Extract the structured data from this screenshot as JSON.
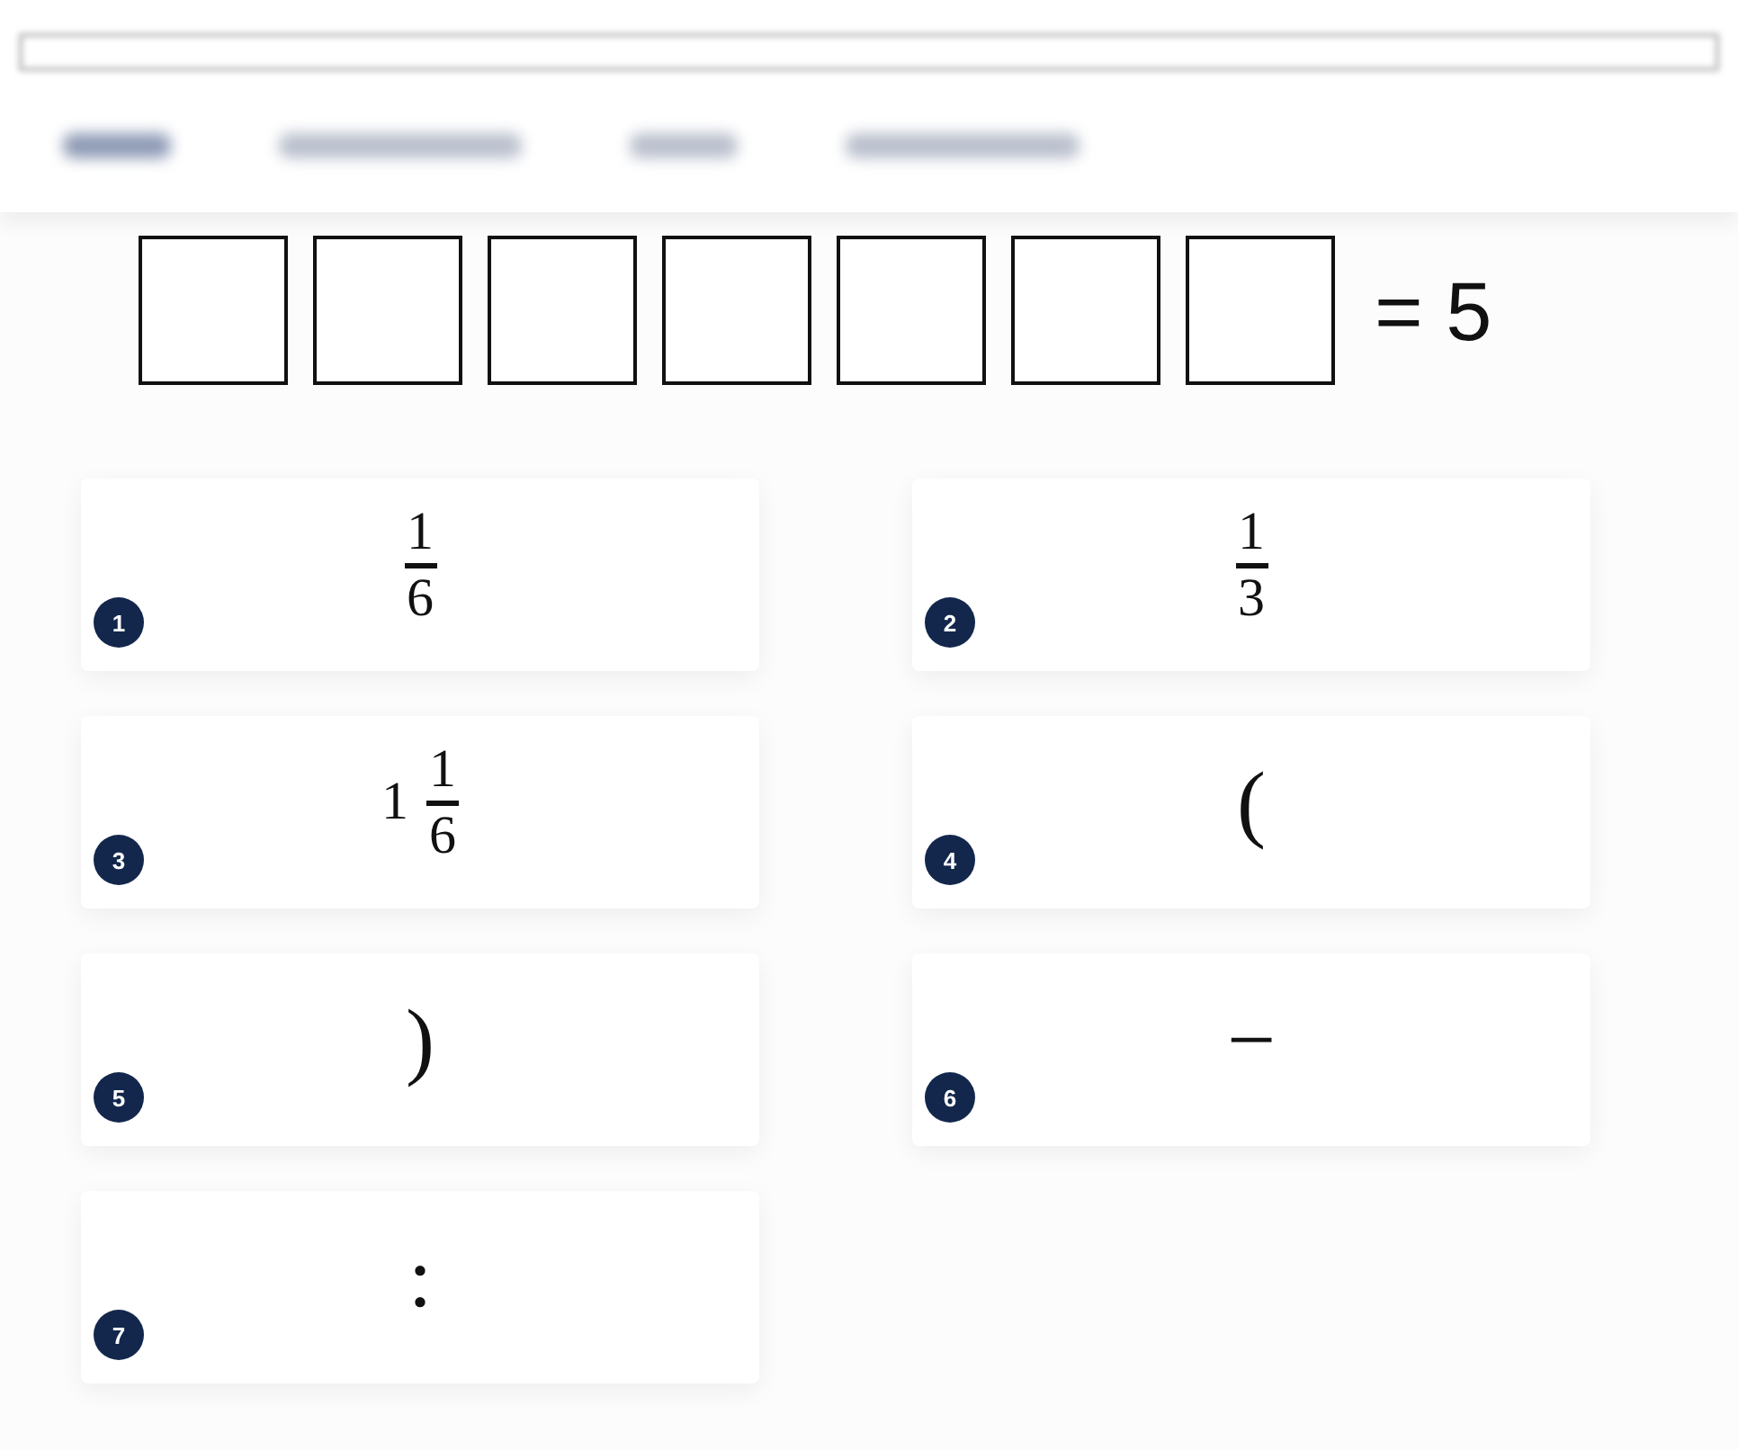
{
  "equation": {
    "slots": [
      {
        "kind": "empty"
      },
      {
        "kind": "empty"
      },
      {
        "kind": "empty"
      },
      {
        "kind": "empty"
      },
      {
        "kind": "empty"
      },
      {
        "kind": "empty"
      },
      {
        "kind": "empty"
      }
    ],
    "result": "= 5"
  },
  "tiles": [
    {
      "number": "1",
      "kind": "fraction",
      "numerator": "1",
      "denominator": "6"
    },
    {
      "number": "2",
      "kind": "fraction",
      "numerator": "1",
      "denominator": "3"
    },
    {
      "number": "3",
      "kind": "mixed",
      "whole": "1",
      "numerator": "1",
      "denominator": "6"
    },
    {
      "number": "4",
      "kind": "symbol",
      "symbol": "("
    },
    {
      "number": "5",
      "kind": "symbol",
      "symbol": ")"
    },
    {
      "number": "6",
      "kind": "symbol",
      "symbol": "−"
    },
    {
      "number": "7",
      "kind": "symbol",
      "symbol": ":"
    }
  ]
}
